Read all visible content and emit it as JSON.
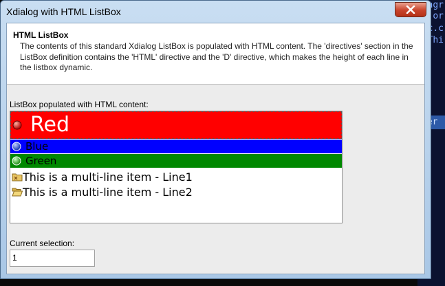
{
  "window": {
    "title": "Xdialog with HTML ListBox"
  },
  "header": {
    "title": "HTML ListBox",
    "description": "The contents of this standard Xdialog ListBox is populated with HTML content. The 'directives' section in the ListBox definition contains the 'HTML' directive and the 'D' directive, which makes the height of each line in the listbox dynamic."
  },
  "listbox": {
    "label": "ListBox populated with HTML content:",
    "items": [
      {
        "text": "Red",
        "background": "#ff0000",
        "icon": "red-ball-icon"
      },
      {
        "text": "Blue",
        "background": "#0000ff",
        "icon": "blue-ball-icon"
      },
      {
        "text": "Green",
        "background": "#008800",
        "icon": "green-ball-icon"
      },
      {
        "text": "This is a multi-line item - Line1",
        "icon": "folder-icon"
      },
      {
        "text": "This is a multi-line item - Line2",
        "icon": "folder-open-icon"
      }
    ]
  },
  "selection": {
    "label": "Current selection:",
    "value": "1"
  },
  "background_code": {
    "lines": [
      "ngr",
      ".or",
      "c.c",
      "Thi",
      "ter"
    ]
  }
}
